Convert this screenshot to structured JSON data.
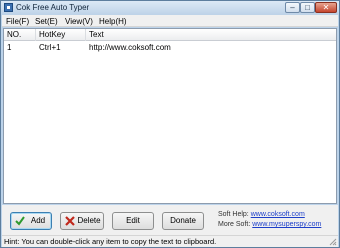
{
  "window": {
    "title": "Cok Free Auto Typer",
    "minimize_glyph": "–",
    "maximize_glyph": "□",
    "close_glyph": "✕"
  },
  "menu": {
    "file": "File(F)",
    "set": "Set(E)",
    "view": "View(V)",
    "help": "Help(H)"
  },
  "list": {
    "columns": {
      "no": "NO.",
      "hotkey": "HotKey",
      "text": "Text"
    },
    "rows": [
      {
        "no": "1",
        "hotkey": "Ctrl+1",
        "text": "http://www.coksoft.com"
      }
    ]
  },
  "buttons": {
    "add": "Add",
    "delete": "Delete",
    "edit": "Edit",
    "donate": "Donate"
  },
  "links": {
    "help_label": "Soft Help:",
    "help_url": "www.coksoft.com",
    "more_label": "More Soft:",
    "more_url": "www.mysuperspy.com"
  },
  "status": {
    "hint": "Hint: You can double-click any item to copy the text to clipboard."
  },
  "icons": {
    "app": "app-icon",
    "add": "check-icon",
    "delete": "x-icon"
  },
  "colors": {
    "accent": "#3c7fb1",
    "link": "#1c3ec9",
    "check": "#2e9a2e",
    "delete": "#c0281c"
  }
}
